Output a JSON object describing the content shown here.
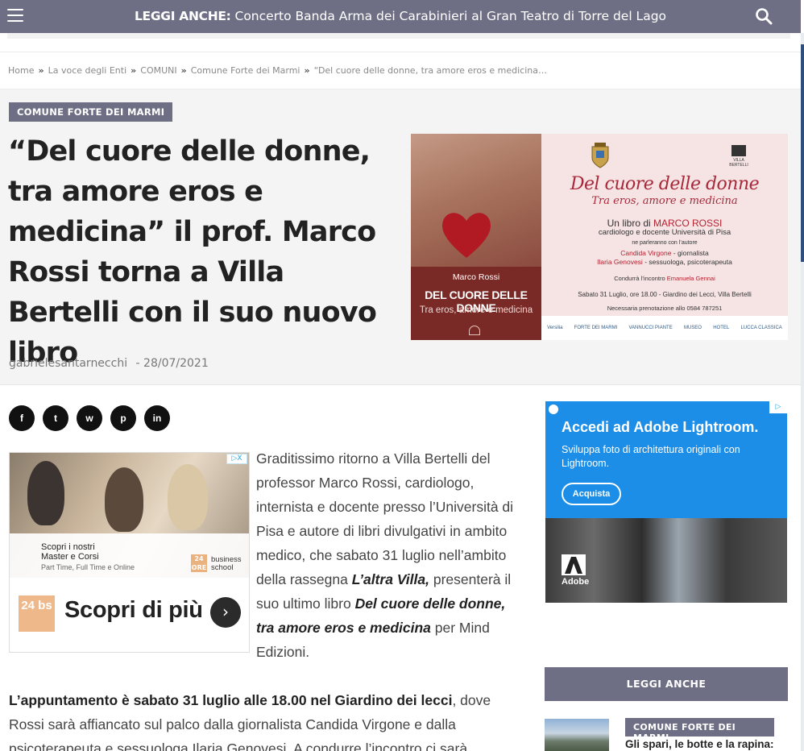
{
  "topbar": {
    "ticker_label": "LEGGI ANCHE:",
    "ticker_text": "Concerto Banda Arma dei Carabinieri al Gran Teatro di Torre del Lago"
  },
  "breadcrumb": {
    "items": [
      "Home",
      "La voce degli Enti",
      "COMUNI",
      "Comune Forte dei Marmi",
      "“Del cuore delle donne, tra amore eros e medicina…"
    ],
    "separator": "»"
  },
  "article": {
    "category": "COMUNE FORTE DEI MARMI",
    "title": "“Del cuore delle donne, tra amore eros e medicina” il prof. Marco Rossi torna a Villa Bertelli con il suo nuovo libro",
    "author": "gabrielesantarnecchi",
    "date": "- 28/07/2021",
    "p1_a": "Graditissimo ritorno a Villa Bertelli del professor Marco Rossi, cardiologo, internista e docente presso l’Università di Pisa e autore di libri divulgativi in ambito medico, che sabato 31 luglio nell’ambito della rassegna ",
    "p1_b": "L’altra Villa,",
    "p1_c": " presenterà il suo ultimo libro ",
    "p1_d": "Del cuore delle donne, tra amore eros e medicina",
    "p1_e": " per Mind Edizioni.",
    "p2_a": "L’appuntamento è sabato 31 luglio alle 18.00 nel Giardino dei lecci",
    "p2_b": ", dove Rossi sarà affiancato sul palco dalla giornalista Candida Virgone e dalla psicoterapeuta e sessuologa Ilaria Genovesi. A condurre l’incontro ci sarà"
  },
  "poster": {
    "left_author": "Marco Rossi",
    "left_title": "DEL CUORE DELLE DONNE",
    "left_sub": "Tra eros, amore e medicina",
    "villa_logo": "VILLA BERTELLI",
    "title": "Del cuore delle donne",
    "subtitle": "Tra eros, amore e medicina",
    "line1": "Un libro di ",
    "line1_name": "MARCO ROSSI",
    "line2": "cardiologo e docente Università di Pisa",
    "line3": "ne parleranno con l’autore",
    "line4_name": "Candida Virgone",
    "line4_role": " - giornalista",
    "line5_name": "Ilaria Genovesi",
    "line5_role": " - sessuologa, psicoterapeuta",
    "line6": "Condurrà l’incontro ",
    "line6_name": "Emanuela Gennai",
    "line7": "Sabato  31 Luglio, ore 18.00 - Giardino dei Lecci, Villa Bertelli",
    "line8": "Necessaria prenotazione allo 0584 787251",
    "sponsors": [
      "Versilia",
      "FORTE DEI MARMI",
      "VANNUCCI PIANTE",
      "MUSEO",
      "HOTEL",
      "LUCCA CLASSICA"
    ]
  },
  "share": {
    "icons": [
      "facebook-icon",
      "twitter-icon",
      "whatsapp-icon",
      "pinterest-icon",
      "linkedin-icon"
    ],
    "glyphs": [
      "f",
      "t",
      "w",
      "p",
      "in"
    ]
  },
  "ad_inline": {
    "adchoice": "▷X",
    "band_title": "Scopri i nostri\nMaster e Corsi",
    "band_small": "Part Time, Full Time e Online",
    "brand_logo": "24 ORE",
    "brand": "business school",
    "logo_text": "24 bs",
    "cta": "Scopri di più",
    "cta_arrow": "›"
  },
  "ad_side": {
    "title": "Accedi ad Adobe Lightroom.",
    "subtitle": "Sviluppa foto di architettura originali con Lightroom.",
    "button": "Acquista",
    "brand": "Adobe",
    "adchoice": "▷"
  },
  "sidebar": {
    "leggi_anche": "LEGGI ANCHE",
    "related_category": "COMUNE FORTE DEI MARMI",
    "related_title": "Gli spari, le botte e la rapina:"
  },
  "colors": {
    "brand": "#6e6f84",
    "poster_red": "#a8283a",
    "ad_blue": "#1c8ee8"
  }
}
